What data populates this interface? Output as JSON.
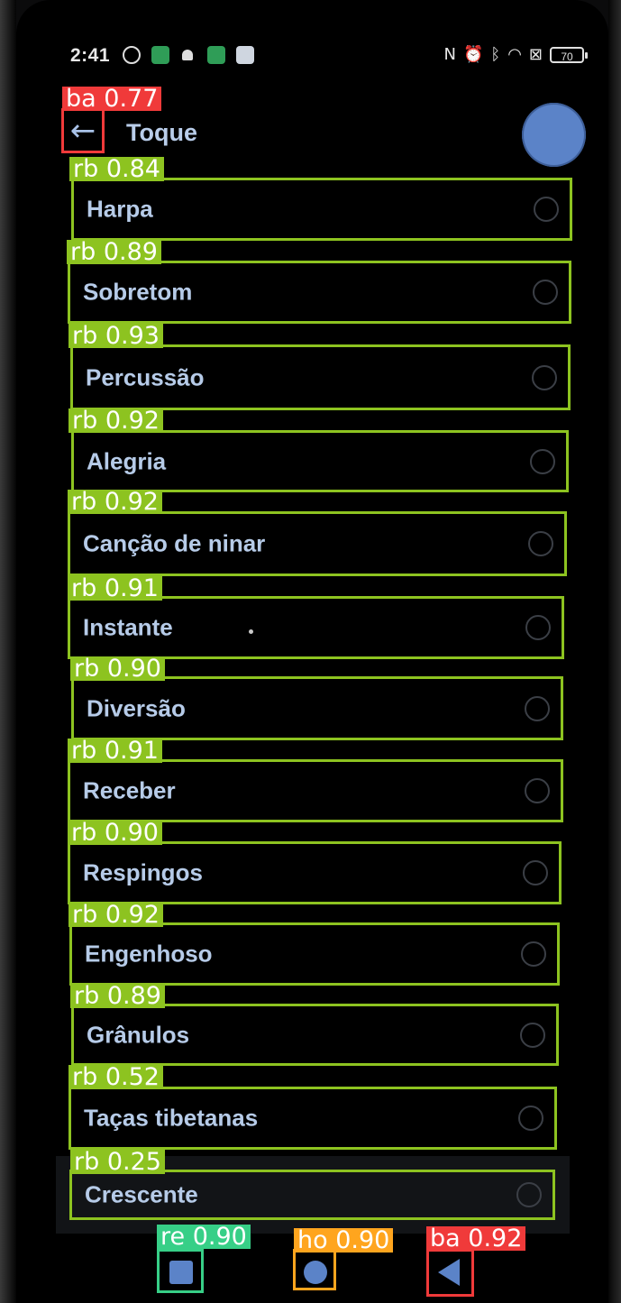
{
  "status_bar": {
    "time": "2:41",
    "battery": "70",
    "left_icons": [
      "settings-icon",
      "grid-app-icon",
      "android-icon",
      "app-icon",
      "message-icon"
    ],
    "right_icons": [
      "nfc-icon",
      "alarm-icon",
      "bluetooth-icon",
      "wifi-icon",
      "close-box-icon",
      "battery-icon"
    ]
  },
  "header": {
    "title": "Toque",
    "back_icon": "arrow-left-icon"
  },
  "ringtones": [
    {
      "label": "Harpa"
    },
    {
      "label": "Sobretom"
    },
    {
      "label": "Percussão"
    },
    {
      "label": "Alegria"
    },
    {
      "label": "Canção de ninar"
    },
    {
      "label": "Instante"
    },
    {
      "label": "Diversão"
    },
    {
      "label": "Receber"
    },
    {
      "label": "Respingos"
    },
    {
      "label": "Engenhoso"
    },
    {
      "label": "Grânulos"
    },
    {
      "label": "Taças tibetanas"
    },
    {
      "label": "Crescente"
    }
  ],
  "detections": {
    "back_header": "ba 0.77",
    "items": [
      "rb 0.84",
      "rb 0.89",
      "rb 0.93",
      "rb 0.92",
      "rb 0.92",
      "rb 0.91",
      "rb 0.90",
      "rb 0.91",
      "rb 0.90",
      "rb 0.92",
      "rb 0.89",
      "rb 0.52",
      "rb 0.25"
    ],
    "nav_recent": "re 0.90",
    "nav_home": "ho 0.90",
    "nav_back": "ba 0.92"
  },
  "colors": {
    "detection_rb": "#8dc320",
    "detection_ba": "#f03a3a",
    "detection_re": "#37cf87",
    "detection_ho": "#ffa51e",
    "accent": "#5b83c8",
    "text": "#b6cbe8"
  }
}
